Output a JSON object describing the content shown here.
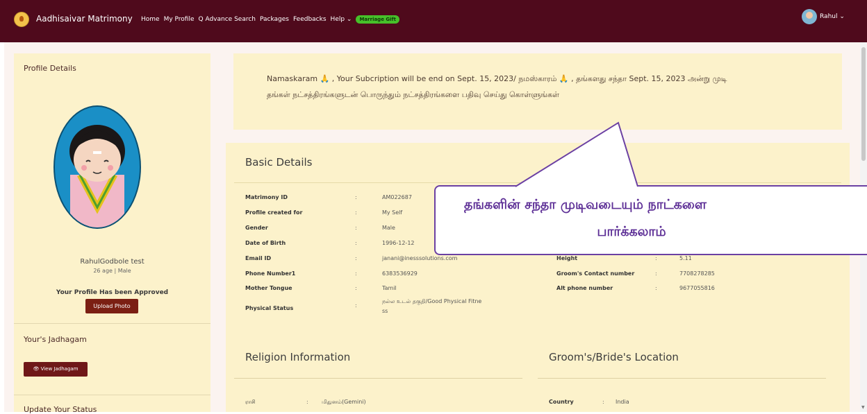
{
  "header": {
    "brand": "Aadhisaivar Matrimony",
    "nav": [
      "Home",
      "My Profile",
      "Q Advance Search",
      "Packages",
      "Feedbacks",
      "Help ⌄"
    ],
    "gift_badge": "Marriage Gift",
    "user": "Rahul ⌄"
  },
  "sidebar": {
    "heading": "Profile Details",
    "name": "RahulGodbole test",
    "age": "26 age | Male",
    "approved": "Your Profile Has been Approved",
    "upload_label": "Upload Photo",
    "jadhagam_heading": "Your's Jadhagam",
    "view_jadhagam": "👁 View Jadhagam",
    "update_heading": "Update Your Status"
  },
  "notice": {
    "line1": "Namaskaram 🙏 , Your Subcription will be end on Sept. 15, 2023/ நமஸ்காரம் 🙏 , தங்களது சந்தா Sept. 15, 2023 அன்று முடி",
    "line2": "தங்கள் நட்சத்திரங்களுடன் பொருந்தும் நட்சத்திரங்களை பதிவு செய்து கொள்ளுங்கள்"
  },
  "basic": {
    "heading": "Basic Details",
    "left_rows": [
      {
        "label": "Matrimony ID",
        "value": "AM022687"
      },
      {
        "label": "Profile created for",
        "value": "My Self"
      },
      {
        "label": "Gender",
        "value": "Male"
      },
      {
        "label": "Date of Birth",
        "value": "1996-12-12"
      },
      {
        "label": "Email ID",
        "value": "janani@inesssolutions.com"
      },
      {
        "label": "Phone Number1",
        "value": "6383536929"
      },
      {
        "label": "Mother Tongue",
        "value": "Tamil"
      },
      {
        "label": "Physical Status",
        "value": "நல்ல உடல் தகுதி/Good Physical Fitne",
        "value2": "ss"
      }
    ],
    "right_rows": [
      {
        "label": "Height",
        "value": "5.11"
      },
      {
        "label": "Groom's Contact number",
        "value": "7708278285"
      },
      {
        "label": "Alt phone number",
        "value": "9677055816"
      }
    ]
  },
  "religion": {
    "heading": "Religion Information",
    "rasi_label": "ராசி",
    "rasi_value": "மிதுனம்(Gemini)"
  },
  "location": {
    "heading": "Groom's/Bride's Location",
    "country_label": "Country",
    "country_value": "India"
  },
  "callout": {
    "line1": "தங்களின் சந்தா முடிவடையும் நாட்களை",
    "line2": "பார்க்கலாம்"
  },
  "colors": {
    "navbar": "#4f0a1c",
    "panel": "#fcf2cb",
    "accent_button": "#7b1f13",
    "callout": "#5d2f96",
    "gift_badge": "#47c02a"
  }
}
